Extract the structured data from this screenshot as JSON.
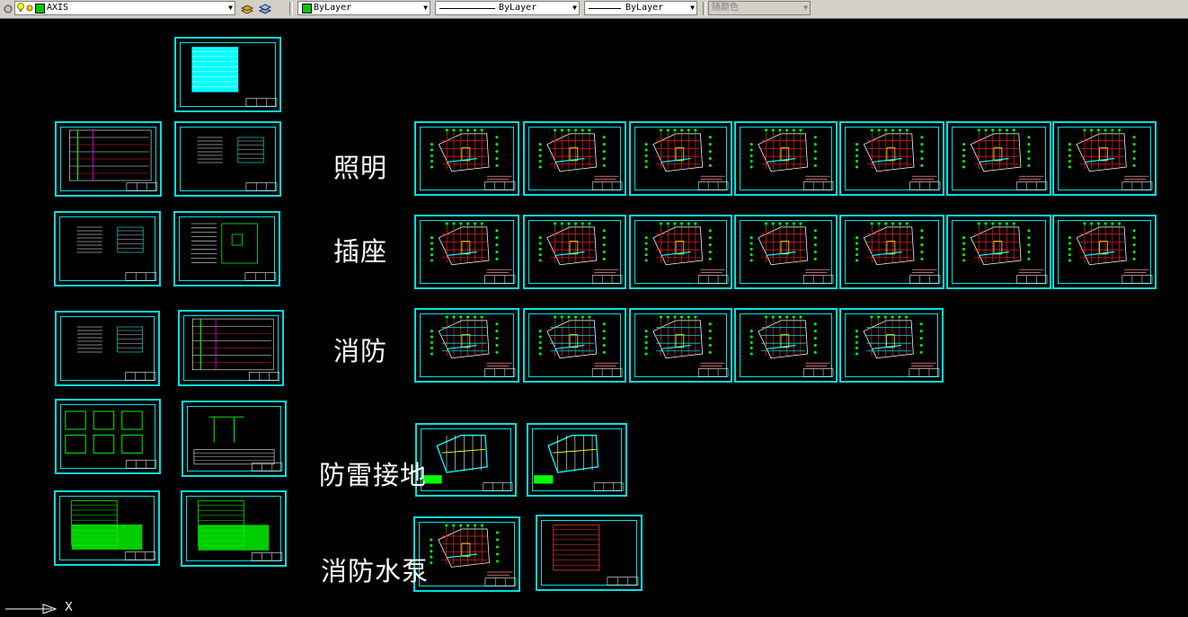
{
  "toolbar": {
    "layer_name": "AXIS",
    "color_value": "ByLayer",
    "linetype_value": "ByLayer",
    "lineweight_value": "ByLayer",
    "plotstyle_value": "随颜色"
  },
  "sections": {
    "lighting": "照明",
    "socket": "插座",
    "fire": "消防",
    "lightning": "防雷接地",
    "pump": "消防水泵"
  },
  "ucs": {
    "x_label": "X"
  },
  "colors": {
    "background": "#000000",
    "sheet_border": "#00e0e0",
    "toolbar": "#d4d0c8",
    "line_green": "#00ff00",
    "line_red": "#ff2020",
    "line_cyan": "#00ffff"
  }
}
